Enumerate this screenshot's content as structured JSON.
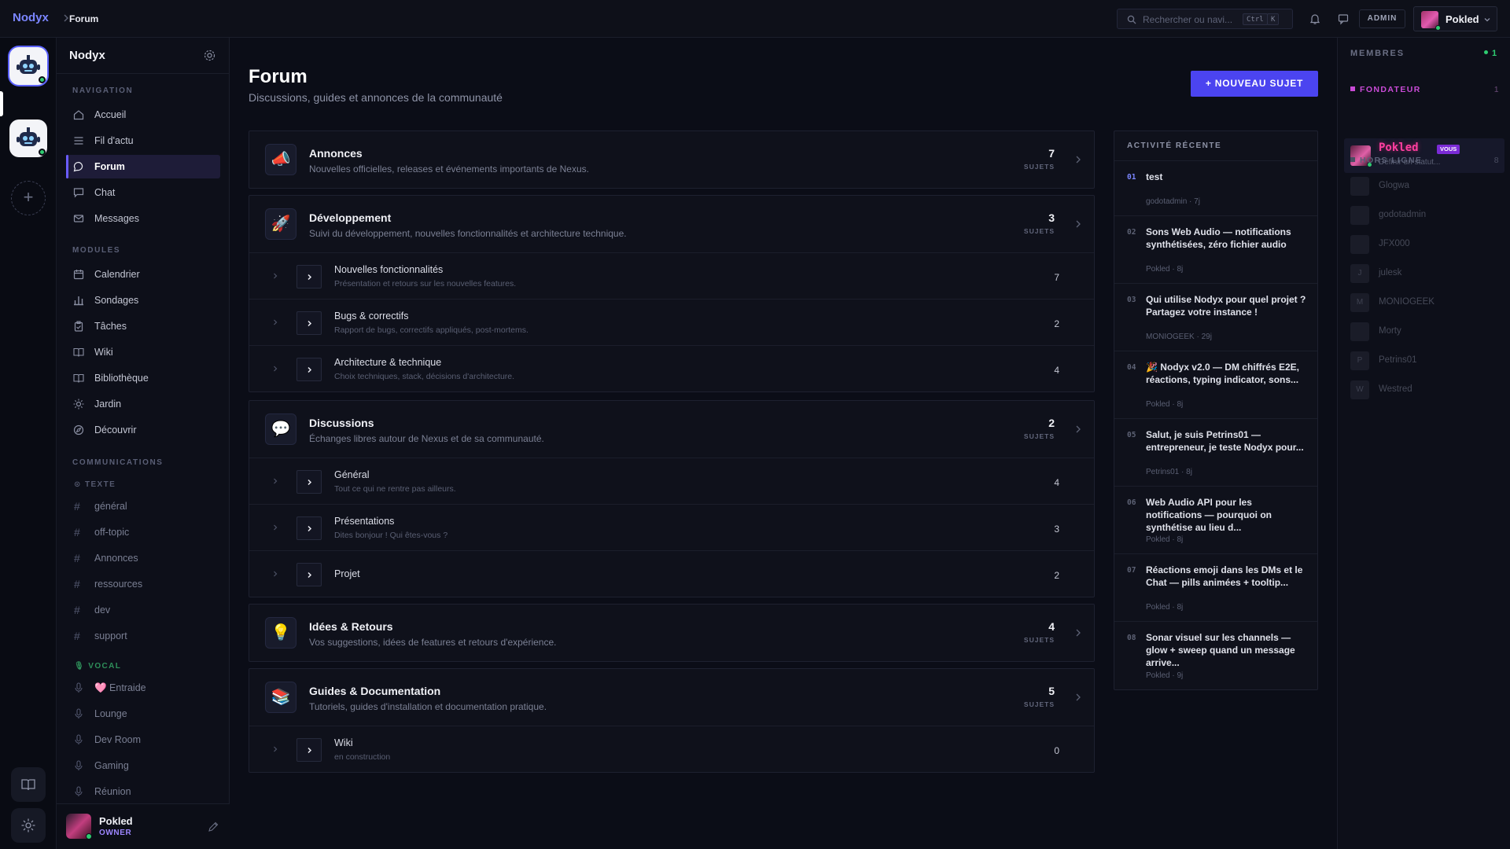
{
  "topbar": {
    "brand": "Nodyx",
    "breadcrumb": "Forum",
    "search_placeholder": "Rechercher ou navi...",
    "kbd_ctrl": "Ctrl",
    "kbd_k": "K",
    "admin_label": "ADMIN",
    "user_name": "Pokled"
  },
  "sidebar": {
    "server_name": "Nodyx",
    "navigation_label": "NAVIGATION",
    "navigation": [
      {
        "label": "Accueil",
        "icon": "home-icon"
      },
      {
        "label": "Fil d'actu",
        "icon": "feed-icon"
      },
      {
        "label": "Forum",
        "icon": "chat-bubble-icon",
        "active": true
      },
      {
        "label": "Chat",
        "icon": "chat-icon"
      },
      {
        "label": "Messages",
        "icon": "mail-icon"
      }
    ],
    "modules_label": "MODULES",
    "modules": [
      {
        "label": "Calendrier",
        "icon": "calendar-icon"
      },
      {
        "label": "Sondages",
        "icon": "poll-icon"
      },
      {
        "label": "Tâches",
        "icon": "clipboard-icon"
      },
      {
        "label": "Wiki",
        "icon": "book-icon"
      },
      {
        "label": "Bibliothèque",
        "icon": "library-icon"
      },
      {
        "label": "Jardin",
        "icon": "sun-icon"
      },
      {
        "label": "Découvrir",
        "icon": "compass-icon"
      }
    ],
    "communications_label": "COMMUNICATIONS",
    "text_label": "TEXTE",
    "text_channels": [
      "général",
      "off-topic",
      "Annonces",
      "ressources",
      "dev",
      "support"
    ],
    "vocal_label": "VOCAL",
    "voice_channels": [
      "🩷 Entraide",
      "Lounge",
      "Dev Room",
      "Gaming",
      "Réunion"
    ],
    "footer": {
      "name": "Pokled",
      "role": "OWNER"
    }
  },
  "main": {
    "title": "Forum",
    "subtitle": "Discussions, guides et annonces de la communauté",
    "new_topic_button": "+ NOUVEAU SUJET",
    "topics_label": "SUJETS",
    "categories": [
      {
        "icon": "📣",
        "name": "Annonces",
        "desc": "Nouvelles officielles, releases et événements importants de Nexus.",
        "count": "7",
        "subs": []
      },
      {
        "icon": "🚀",
        "name": "Développement",
        "desc": "Suivi du développement, nouvelles fonctionnalités et architecture technique.",
        "count": "3",
        "subs": [
          {
            "name": "Nouvelles fonctionnalités",
            "desc": "Présentation et retours sur les nouvelles features.",
            "count": "7"
          },
          {
            "name": "Bugs & correctifs",
            "desc": "Rapport de bugs, correctifs appliqués, post-mortems.",
            "count": "2"
          },
          {
            "name": "Architecture & technique",
            "desc": "Choix techniques, stack, décisions d'architecture.",
            "count": "4"
          }
        ]
      },
      {
        "icon": "💬",
        "name": "Discussions",
        "desc": "Échanges libres autour de Nexus et de sa communauté.",
        "count": "2",
        "subs": [
          {
            "name": "Général",
            "desc": "Tout ce qui ne rentre pas ailleurs.",
            "count": "4"
          },
          {
            "name": "Présentations",
            "desc": "Dites bonjour ! Qui êtes-vous ?",
            "count": "3"
          },
          {
            "name": "Projet",
            "desc": "",
            "count": "2"
          }
        ]
      },
      {
        "icon": "💡",
        "name": "Idées & Retours",
        "desc": "Vos suggestions, idées de features et retours d'expérience.",
        "count": "4",
        "subs": []
      },
      {
        "icon": "📚",
        "name": "Guides & Documentation",
        "desc": "Tutoriels, guides d'installation et documentation pratique.",
        "count": "5",
        "subs": [
          {
            "name": "Wiki",
            "desc": "en construction",
            "count": "0"
          }
        ]
      }
    ],
    "activity_title": "ACTIVITÉ RÉCENTE",
    "activity": [
      {
        "num": "01",
        "title": "test",
        "author": "godotadmin",
        "ago": "7j"
      },
      {
        "num": "02",
        "title": "Sons Web Audio — notifications synthétisées, zéro fichier audio",
        "author": "Pokled",
        "ago": "8j"
      },
      {
        "num": "03",
        "title": "Qui utilise Nodyx pour quel projet ? Partagez votre instance !",
        "author": "MONIOGEEK",
        "ago": "29j"
      },
      {
        "num": "04",
        "title": "🎉 Nodyx v2.0 — DM chiffrés E2E, réactions, typing indicator, sons...",
        "author": "Pokled",
        "ago": "8j"
      },
      {
        "num": "05",
        "title": "Salut, je suis Petrins01 — entrepreneur, je teste Nodyx pour...",
        "author": "Petrins01",
        "ago": "8j"
      },
      {
        "num": "06",
        "title": "Web Audio API pour les notifications — pourquoi on synthétise au lieu d...",
        "author": "Pokled",
        "ago": "8j"
      },
      {
        "num": "07",
        "title": "Réactions emoji dans les DMs et le Chat — pills animées + tooltip...",
        "author": "Pokled",
        "ago": "8j"
      },
      {
        "num": "08",
        "title": "Sonar visuel sur les channels — glow + sweep quand un message arrive...",
        "author": "Pokled",
        "ago": "9j"
      }
    ]
  },
  "members": {
    "title": "MEMBRES",
    "online_count": "1",
    "founder_label": "FONDATEUR",
    "founder_count": "1",
    "founder": {
      "name": "Pokled",
      "badge": "VOUS",
      "status": "Définir un statut..."
    },
    "offline_label": "HORS LIGNE",
    "offline_count": "8",
    "offline": [
      {
        "name": "Glogwa",
        "initial": ""
      },
      {
        "name": "godotadmin",
        "initial": ""
      },
      {
        "name": "JFX000",
        "initial": ""
      },
      {
        "name": "julesk",
        "initial": "J"
      },
      {
        "name": "MONIOGEEK",
        "initial": "M"
      },
      {
        "name": "Morty",
        "initial": ""
      },
      {
        "name": "Petrins01",
        "initial": "P"
      },
      {
        "name": "Westred",
        "initial": "W"
      }
    ]
  },
  "colors": {
    "accent": "#4b44f0",
    "brand": "#7b86ff",
    "online": "#2ecc71",
    "founder_name": "#ff3fa0"
  }
}
